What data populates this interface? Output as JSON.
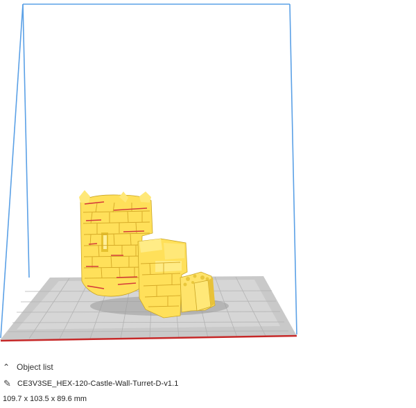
{
  "object_list": {
    "toggle_icon": "chevron-up-icon",
    "header_label": "Object list",
    "item": {
      "edit_icon": "pencil-icon",
      "name": "CE3V3SE_HEX-120-Castle-Wall-Turret-D-v1.1"
    },
    "dimensions": "109.7 x 103.5 x 89.6 mm"
  },
  "colors": {
    "build_volume_edge": "#5aa0e6",
    "build_plate": "#c8c8c8",
    "build_plate_grid": "#a9a9a9",
    "model": "#ffe15a",
    "overhang_highlight": "#d43a3a"
  }
}
